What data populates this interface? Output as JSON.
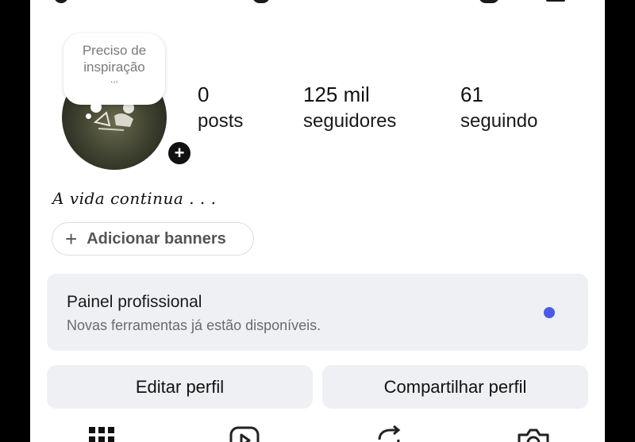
{
  "note": {
    "line1": "Preciso de",
    "line2": "inspiração",
    "dots": "..."
  },
  "stats": {
    "posts": {
      "value": "0",
      "label": "posts"
    },
    "followers": {
      "value": "125 mil",
      "label": "seguidores"
    },
    "following": {
      "value": "61",
      "label": "seguindo"
    }
  },
  "bio": "A vida continua . . .",
  "banners": {
    "plus": "+",
    "label": "Adicionar banners"
  },
  "panel": {
    "title": "Painel profissional",
    "subtitle": "Novas ferramentas já estão disponíveis.",
    "dot_color": "#4a5be6"
  },
  "buttons": {
    "edit": "Editar perfil",
    "share": "Compartilhar perfil"
  },
  "add_story": "+",
  "tabs": [
    {
      "icon": "grid-icon"
    },
    {
      "icon": "reels-icon"
    },
    {
      "icon": "reposts-icon"
    },
    {
      "icon": "tagged-icon"
    }
  ]
}
